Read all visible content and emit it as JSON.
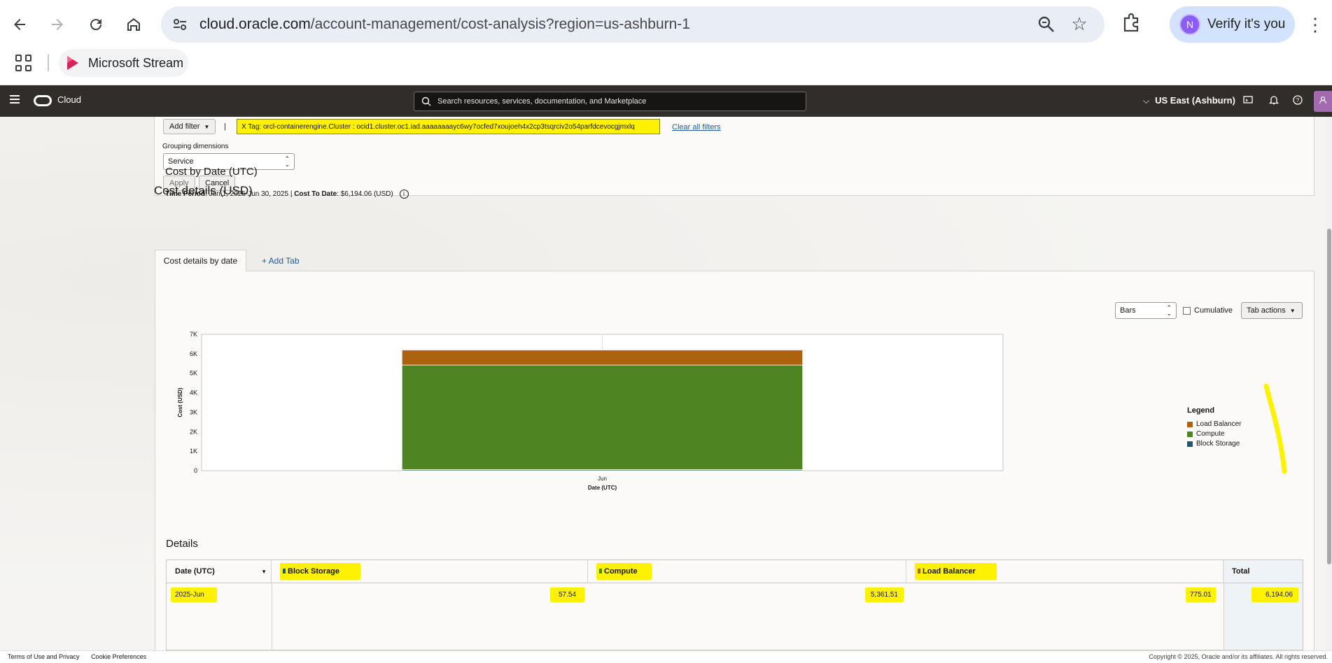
{
  "browser": {
    "url_host": "cloud.oracle.com",
    "url_path": "/account-management/cost-analysis?region=us-ashburn-1",
    "verify_label": "Verify it's you",
    "profile_initial": "N",
    "bookmark_label": "Microsoft Stream"
  },
  "oci_header": {
    "brand": "Cloud",
    "search_placeholder": "Search resources, services, documentation, and Marketplace",
    "region": "US East (Ashburn)"
  },
  "filters": {
    "add_filter_label": "Add filter",
    "separator": "|",
    "chip_text": "X Tag: orcl-containerengine.Cluster : ocid1.cluster.oc1.iad.aaaaaaaayc6wy7ocfed7xoujoeh4x2cp3tsqrciv2o54parfdcevocgjmxlq",
    "clear_all_label": "Clear all filters",
    "grouping_label": "Grouping dimensions",
    "grouping_value": "Service",
    "apply_label": "Apply",
    "cancel_label": "Cancel"
  },
  "cost_details": {
    "title": "Cost details (USD)",
    "tab_active": "Cost details by date",
    "tab_add": "+ Add Tab",
    "chart_title": "Cost by Date (UTC)",
    "time_period_label": "Time Period",
    "time_period_value": ": Jun 1, 2025-Jun 30, 2025 |",
    "cost_to_date_label": "Cost To Date",
    "cost_to_date_value": ": $6,194.06 (USD)",
    "chart_type_value": "Bars",
    "cumulative_label": "Cumulative",
    "tab_actions_label": "Tab actions"
  },
  "chart_data": {
    "type": "bar",
    "stacked": true,
    "categories": [
      "Jun"
    ],
    "xlabel": "Date (UTC)",
    "ylabel": "Cost (USD)",
    "ylim": [
      0,
      7000
    ],
    "yticks": [
      "0",
      "1K",
      "2K",
      "3K",
      "4K",
      "5K",
      "6K",
      "7K"
    ],
    "grid": true,
    "legend_title": "Legend",
    "legend_position": "right",
    "series": [
      {
        "name": "Block Storage",
        "values": [
          57.54
        ],
        "color": "#1f5a6e"
      },
      {
        "name": "Compute",
        "values": [
          5361.51
        ],
        "color": "#4e8520"
      },
      {
        "name": "Load Balancer",
        "values": [
          775.01
        ],
        "color": "#ad620e"
      }
    ],
    "legend_order": [
      "Load Balancer",
      "Compute",
      "Block Storage"
    ]
  },
  "details": {
    "title": "Details",
    "columns": [
      "Date (UTC)",
      "Block Storage",
      "Compute",
      "Load Balancer",
      "Total"
    ],
    "rows": [
      {
        "date": "2025-Jun",
        "block_storage": "57.54",
        "compute": "5,361.51",
        "load_balancer": "775.01",
        "total": "6,194.06"
      }
    ]
  },
  "footer": {
    "terms": "Terms of Use and Privacy",
    "cookies": "Cookie Preferences",
    "copyright": "Copyright © 2025, Oracle and/or its affiliates. All rights reserved."
  },
  "colors": {
    "highlight": "#fff200",
    "header_bg": "#312d2a",
    "link": "#1d5b9c"
  }
}
